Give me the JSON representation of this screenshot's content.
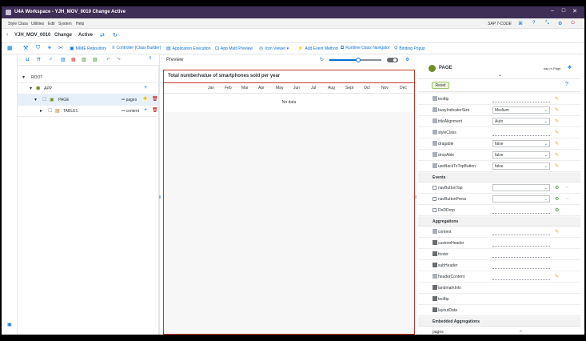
{
  "window": {
    "title": "U4A Workspace - YJH_MOV_0010 Change Active",
    "controls": [
      "–",
      "□",
      "✕"
    ]
  },
  "menubar": {
    "items": [
      "Style Class",
      "Utilities",
      "Edit",
      "System",
      "Help"
    ],
    "sap_code": "SAP T-CODE"
  },
  "shellbar": {
    "app_name": "YJH_MOV_0010",
    "mode": "Change",
    "status": "Active"
  },
  "toolbar": {
    "buttons": [
      "MIME Repository",
      "Controller (Class Builder)",
      "Application Execution",
      "App Multi Preview",
      "Icon Viewer",
      "Add Event Method",
      "Runtime Class Navigator",
      "Binding Popup"
    ]
  },
  "tree": {
    "rows": [
      {
        "label": "ROOT",
        "aggregation": ""
      },
      {
        "label": "APP",
        "aggregation": ""
      },
      {
        "label": "PAGE",
        "aggregation": "pages"
      },
      {
        "label": "TABLE1",
        "aggregation": "content"
      }
    ]
  },
  "preview": {
    "label": "Preview",
    "title": "Total number/value of smartphones sold per year",
    "columns": [
      "Jan",
      "Feb",
      "Mar",
      "Apr",
      "May",
      "Jun",
      "Jul",
      "Aug",
      "Sept",
      "Oct",
      "Nov",
      "Dec"
    ],
    "no_data": "No data",
    "zoom_fraction": 0.55
  },
  "props": {
    "header_name": "PAGE",
    "nav_label": "sap.m.Page",
    "reset_label": "Reset",
    "properties": [
      {
        "name": "tooltip",
        "value": "",
        "kind": "line"
      },
      {
        "name": "busyIndicatorSize",
        "value": "Medium",
        "kind": "select"
      },
      {
        "name": "titleAlignment",
        "value": "Auto",
        "kind": "select"
      },
      {
        "name": "styleClass",
        "value": "",
        "kind": "line"
      },
      {
        "name": "dragable",
        "value": "false",
        "kind": "select"
      },
      {
        "name": "dropAble",
        "value": "false",
        "kind": "select"
      },
      {
        "name": "useBackToTopButton",
        "value": "false",
        "kind": "select"
      }
    ],
    "events_header": "Events",
    "events": [
      {
        "name": "navButtonTap"
      },
      {
        "name": "navButtonPress"
      },
      {
        "name": "DnDDrop"
      }
    ],
    "aggregations_header": "Aggregations",
    "aggregations": [
      {
        "name": "content"
      },
      {
        "name": "customHeader"
      },
      {
        "name": "footer"
      },
      {
        "name": "subHeader"
      },
      {
        "name": "headerContent"
      },
      {
        "name": "landmarkInfo"
      },
      {
        "name": "tooltip"
      },
      {
        "name": "layoutData"
      }
    ],
    "embedded_header": "Embedded Aggregations",
    "embedded": [
      {
        "name": "pages"
      }
    ]
  },
  "colors": {
    "titlebar": "#3d2f55",
    "accent": "#0a6ed1",
    "preview_border": "#c0392b"
  }
}
